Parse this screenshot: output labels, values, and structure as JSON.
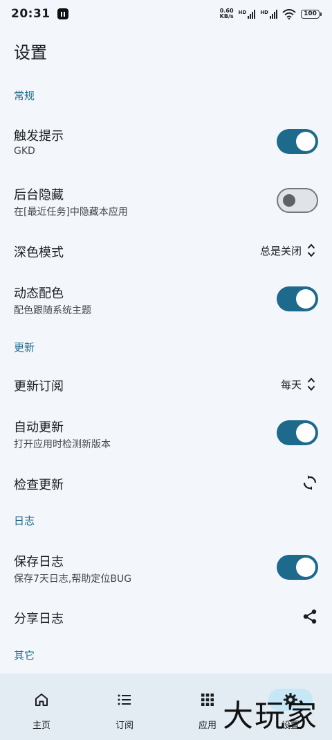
{
  "status": {
    "time": "20:31",
    "speed_value": "0.60",
    "speed_unit": "KB/s",
    "hd_label": "HD",
    "battery": "100"
  },
  "page": {
    "title": "设置"
  },
  "sections": {
    "general": "常规",
    "update": "更新",
    "log": "日志",
    "other": "其它"
  },
  "settings": {
    "trigger_tip": {
      "title": "触发提示",
      "subtitle": "GKD",
      "enabled": true
    },
    "hide_background": {
      "title": "后台隐藏",
      "subtitle": "在[最近任务]中隐藏本应用",
      "enabled": false
    },
    "dark_mode": {
      "title": "深色模式",
      "value": "总是关闭"
    },
    "dynamic_color": {
      "title": "动态配色",
      "subtitle": "配色跟随系统主题",
      "enabled": true
    },
    "update_subscription": {
      "title": "更新订阅",
      "value": "每天"
    },
    "auto_update": {
      "title": "自动更新",
      "subtitle": "打开应用时检测新版本",
      "enabled": true
    },
    "check_update": {
      "title": "检查更新"
    },
    "save_log": {
      "title": "保存日志",
      "subtitle": "保存7天日志,帮助定位BUG",
      "enabled": true
    },
    "share_log": {
      "title": "分享日志"
    }
  },
  "nav": {
    "home": "主页",
    "subscriptions": "订阅",
    "apps": "应用",
    "settings": "设置"
  },
  "colors": {
    "accent": "#1e6a8d",
    "section": "#1f6a8a",
    "background": "#f3f7fb",
    "nav_background": "#e3ecf3"
  },
  "watermark": "大玩家"
}
